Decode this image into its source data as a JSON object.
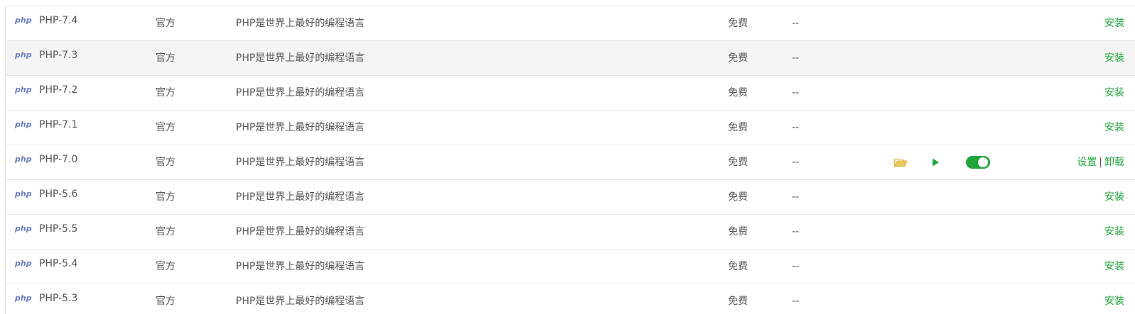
{
  "columns": {
    "developer": "官方",
    "description": "PHP是世界上最好的编程语言",
    "price": "免费",
    "expiry": "--"
  },
  "logo_text": "php",
  "actions": {
    "install": "安装",
    "settings": "设置",
    "separator": "|",
    "uninstall": "卸载"
  },
  "colors": {
    "accent_green": "#20a53a",
    "folder_yellow": "#e8c65a",
    "row_highlight": "#f5f5f5"
  },
  "rows": [
    {
      "name": "PHP-7.4",
      "developer": "官方",
      "description": "PHP是世界上最好的编程语言",
      "price": "免费",
      "expiry": "--",
      "action": "安装"
    },
    {
      "name": "PHP-7.3",
      "developer": "官方",
      "description": "PHP是世界上最好的编程语言",
      "price": "免费",
      "expiry": "--",
      "action": "安装"
    },
    {
      "name": "PHP-7.2",
      "developer": "官方",
      "description": "PHP是世界上最好的编程语言",
      "price": "免费",
      "expiry": "--",
      "action": "安装"
    },
    {
      "name": "PHP-7.1",
      "developer": "官方",
      "description": "PHP是世界上最好的编程语言",
      "price": "免费",
      "expiry": "--",
      "action": "安装"
    },
    {
      "name": "PHP-7.0",
      "developer": "官方",
      "description": "PHP是世界上最好的编程语言",
      "price": "免费",
      "expiry": "--",
      "installed": true,
      "settings": "设置",
      "uninstall": "卸载",
      "enabled": true
    },
    {
      "name": "PHP-5.6",
      "developer": "官方",
      "description": "PHP是世界上最好的编程语言",
      "price": "免费",
      "expiry": "--",
      "action": "安装"
    },
    {
      "name": "PHP-5.5",
      "developer": "官方",
      "description": "PHP是世界上最好的编程语言",
      "price": "免费",
      "expiry": "--",
      "action": "安装"
    },
    {
      "name": "PHP-5.4",
      "developer": "官方",
      "description": "PHP是世界上最好的编程语言",
      "price": "免费",
      "expiry": "--",
      "action": "安装"
    },
    {
      "name": "PHP-5.3",
      "developer": "官方",
      "description": "PHP是世界上最好的编程语言",
      "price": "免费",
      "expiry": "--",
      "action": "安装"
    }
  ]
}
